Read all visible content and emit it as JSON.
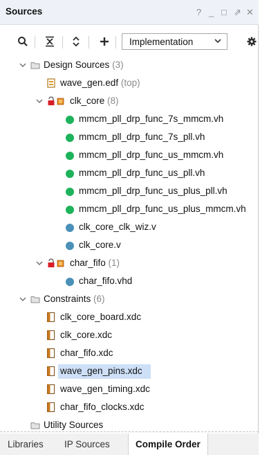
{
  "panel": {
    "title": "Sources",
    "controls": {
      "help": "?",
      "minimize": "_",
      "restore": "□",
      "float": "⇗",
      "close": "✕"
    }
  },
  "toolbar": {
    "search_icon": "search-icon",
    "collapse_icon": "collapse-all-icon",
    "expand_icon": "expand-all-icon",
    "add_icon": "plus-icon",
    "view_select": {
      "value": "Implementation"
    },
    "settings_icon": "gear-icon"
  },
  "tree": {
    "design_sources": {
      "label": "Design Sources",
      "count": "(3)"
    },
    "wave_gen_edf": {
      "label": "wave_gen.edf",
      "suffix": "(top)"
    },
    "clk_core": {
      "label": "clk_core",
      "count": "(8)"
    },
    "clk_core_children": [
      "mmcm_pll_drp_func_7s_mmcm.vh",
      "mmcm_pll_drp_func_7s_pll.vh",
      "mmcm_pll_drp_func_us_mmcm.vh",
      "mmcm_pll_drp_func_us_pll.vh",
      "mmcm_pll_drp_func_us_plus_pll.vh",
      "mmcm_pll_drp_func_us_plus_mmcm.vh",
      "clk_core_clk_wiz.v",
      "clk_core.v"
    ],
    "char_fifo": {
      "label": "char_fifo",
      "count": "(1)"
    },
    "char_fifo_children": [
      "char_fifo.vhd"
    ],
    "constraints": {
      "label": "Constraints",
      "count": "(6)"
    },
    "constraint_files": [
      "clk_core_board.xdc",
      "clk_core.xdc",
      "char_fifo.xdc",
      "wave_gen_pins.xdc",
      "wave_gen_timing.xdc",
      "char_fifo_clocks.xdc"
    ],
    "utility_sources": {
      "label": "Utility Sources"
    }
  },
  "tabs": [
    "Libraries",
    "IP Sources",
    "Compile Order"
  ],
  "colors": {
    "verilog_header_dot": "#1db35a",
    "verilog_dot": "#4a90b8",
    "selection": "#cde0f7",
    "titlebar": "#eef2f8"
  }
}
